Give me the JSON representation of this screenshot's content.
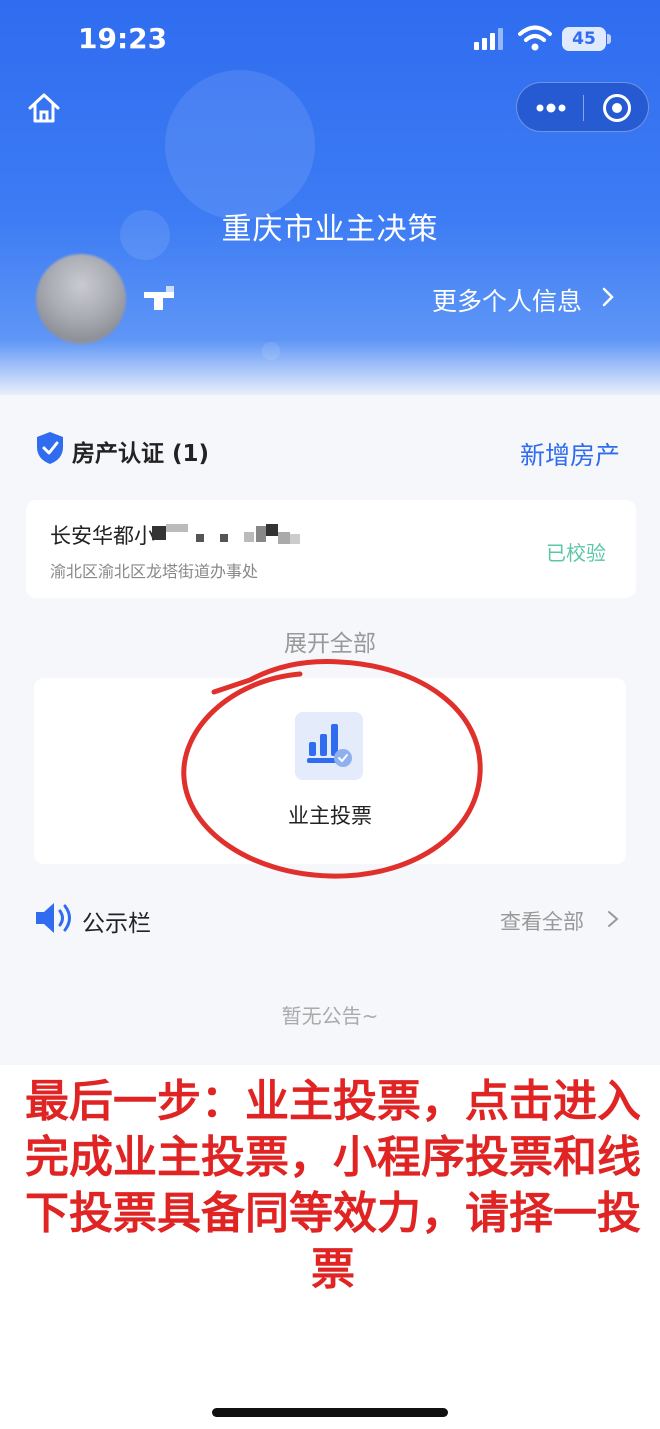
{
  "status_bar": {
    "time": "19:23",
    "battery": "45"
  },
  "header": {
    "title": "重庆市业主决策",
    "more_info": "更多个人信息",
    "brand_color": "#2f6cf0"
  },
  "property_section": {
    "title": "房产认证 (1)",
    "add_label": "新增房产",
    "item": {
      "name": "长安华都小",
      "address": "渝北区渝北区龙塔街道办事处",
      "status": "已校验",
      "status_color": "#5cc6a6"
    },
    "expand_label": "展开全部"
  },
  "vote_card": {
    "label": "业主投票",
    "annotation_color": "#e0302c"
  },
  "notice_section": {
    "title": "公示栏",
    "view_all": "查看全部",
    "empty": "暂无公告~"
  },
  "caption": {
    "text": "最后一步：业主投票，点击进入完成业主投票，小程序投票和线下投票具备同等效力，请择一投票",
    "color": "#e02424"
  },
  "icons": [
    "home-icon",
    "more-dots-icon",
    "close-target-icon",
    "shield-check-icon",
    "vote-chart-icon",
    "speaker-icon",
    "chevron-right-icon"
  ]
}
